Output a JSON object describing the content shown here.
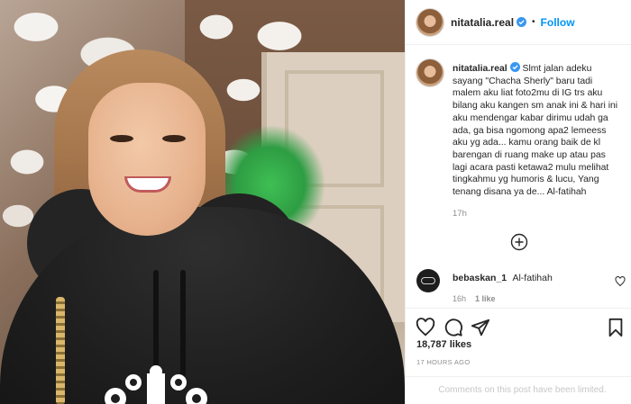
{
  "post": {
    "username": "nitatalia.real",
    "dot": "•",
    "follow_label": "Follow",
    "caption": "Slmt jalan adeku sayang \"Chacha Sherly\" baru tadi malem aku liat foto2mu di IG trs aku bilang aku kangen sm anak ini & hari ini aku mendengar kabar dirimu udah ga ada, ga bisa ngomong apa2 lemeess aku yg ada... kamu orang baik de kl barengan di ruang make up atau pas lagi acara pasti ketawa2 mulu melihat tingkahmu yg humoris & lucu, Yang tenang disana ya de... Al-fatihah",
    "caption_age": "17h",
    "likes": "18,787 likes",
    "posted": "17 HOURS AGO",
    "comments_limited": "Comments on this post have been limited."
  },
  "comment": {
    "username": "bebaskan_1",
    "text": "Al-fatihah",
    "age": "16h",
    "likes": "1 like"
  },
  "icons": {
    "verified": "verified-badge-icon",
    "load_more": "plus-circle-icon",
    "like": "heart-icon",
    "comment": "speech-bubble-icon",
    "share": "paper-plane-icon",
    "save": "bookmark-icon",
    "comment_like": "small-heart-icon"
  },
  "colors": {
    "follow": "#0095f6",
    "verified": "#3897f0",
    "muted": "#8e8e8e"
  }
}
